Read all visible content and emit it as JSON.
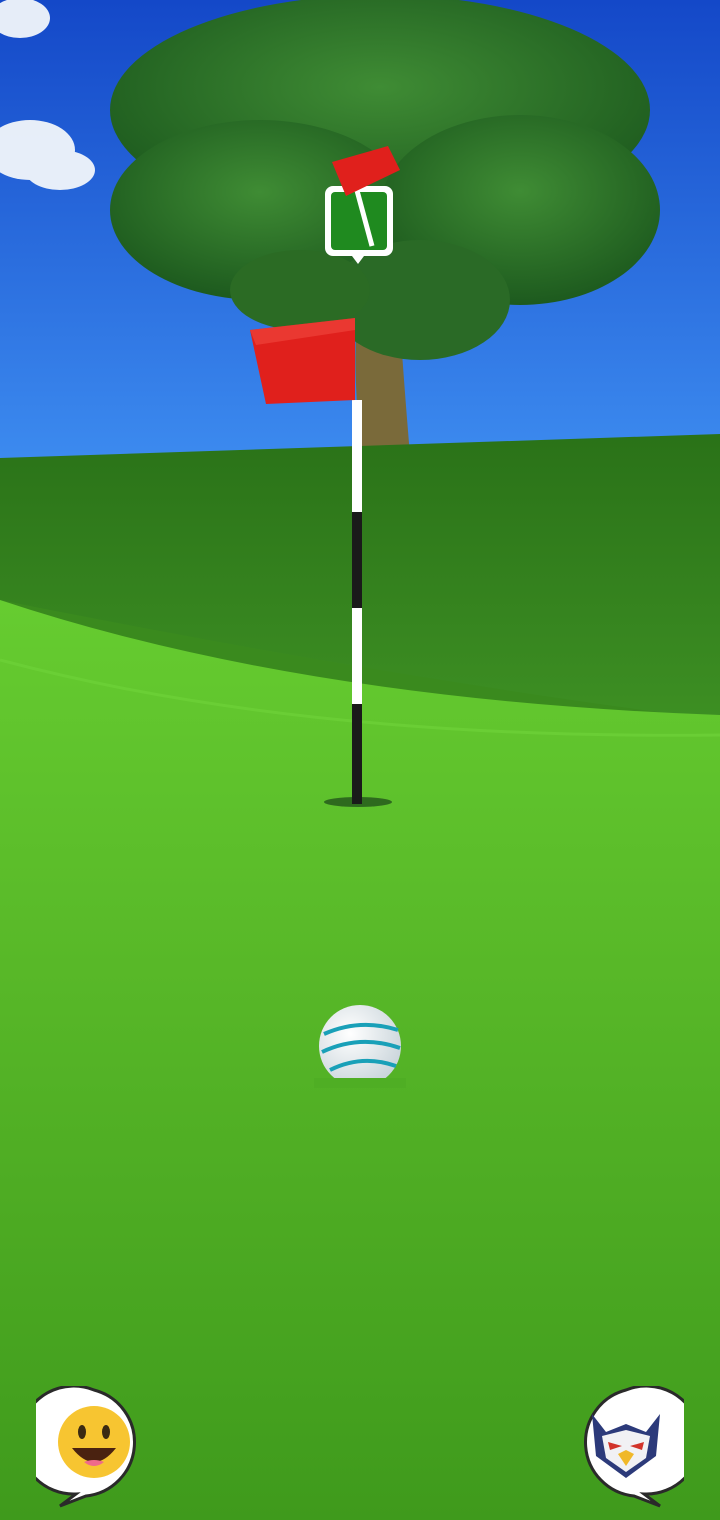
{
  "scene": {
    "sky_color": "#1f5fd6",
    "fairway_color": "#5ec72c",
    "hill_color": "#2f7a1c",
    "flag_color": "#e0201c"
  },
  "hud": {
    "target_marker_icon": "flag-target-marker-icon",
    "emoji_button_icon": "grinning-face-icon",
    "opponent_avatar_icon": "eagle-mascot-avatar-icon"
  }
}
